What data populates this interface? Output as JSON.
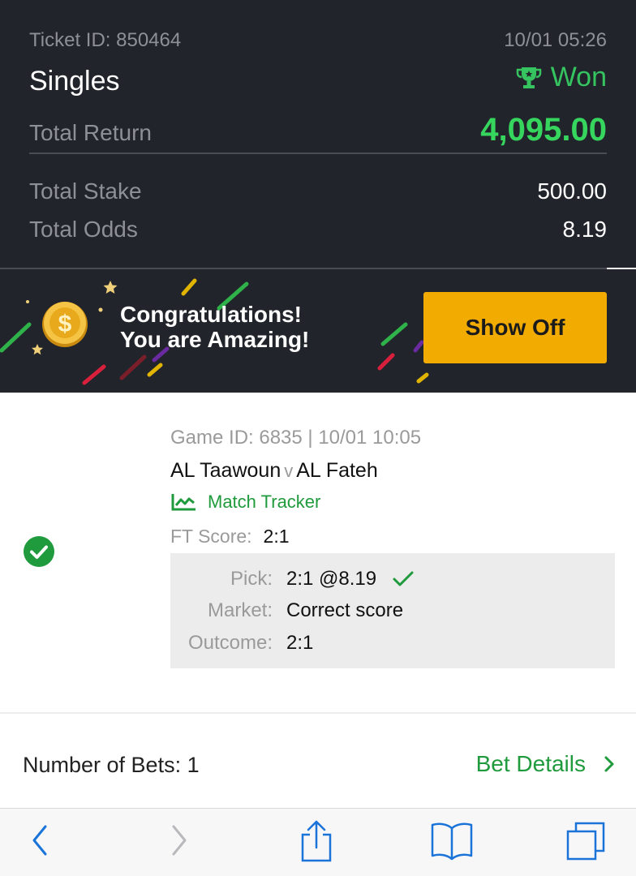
{
  "ticket": {
    "id_label": "Ticket ID: 850464",
    "datetime": "10/01 05:26",
    "type": "Singles",
    "status": "Won",
    "total_return_label": "Total Return",
    "total_return": "4,095.00",
    "total_stake_label": "Total Stake",
    "total_stake": "500.00",
    "total_odds_label": "Total Odds",
    "total_odds": "8.19"
  },
  "banner": {
    "line1": "Congratulations!",
    "line2": "You are Amazing!",
    "button": "Show Off"
  },
  "bet": {
    "game_id": "Game ID: 6835 | 10/01 10:05",
    "home": "AL Taawoun",
    "versus": "v",
    "away": "AL Fateh",
    "tracker": "Match Tracker",
    "ft_score_label": "FT Score:",
    "ft_score": "2:1",
    "pick_label": "Pick:",
    "pick": "2:1 @8.19",
    "market_label": "Market:",
    "market": "Correct score",
    "outcome_label": "Outcome:",
    "outcome": "2:1"
  },
  "footer": {
    "num_bets": "Number of Bets: 1",
    "bet_details": "Bet Details"
  },
  "colors": {
    "panel_bg": "#22242b",
    "win_green": "#36d65e",
    "link_green": "#1f9a3c",
    "button_yellow": "#f2ab00",
    "ios_blue": "#1a73d9"
  },
  "icons": [
    "trophy-icon",
    "coin-icon",
    "check-circle-icon",
    "tracker-icon",
    "tick-icon",
    "chevron-right-icon",
    "back-icon",
    "forward-icon",
    "share-icon",
    "bookmarks-icon",
    "tabs-icon"
  ]
}
